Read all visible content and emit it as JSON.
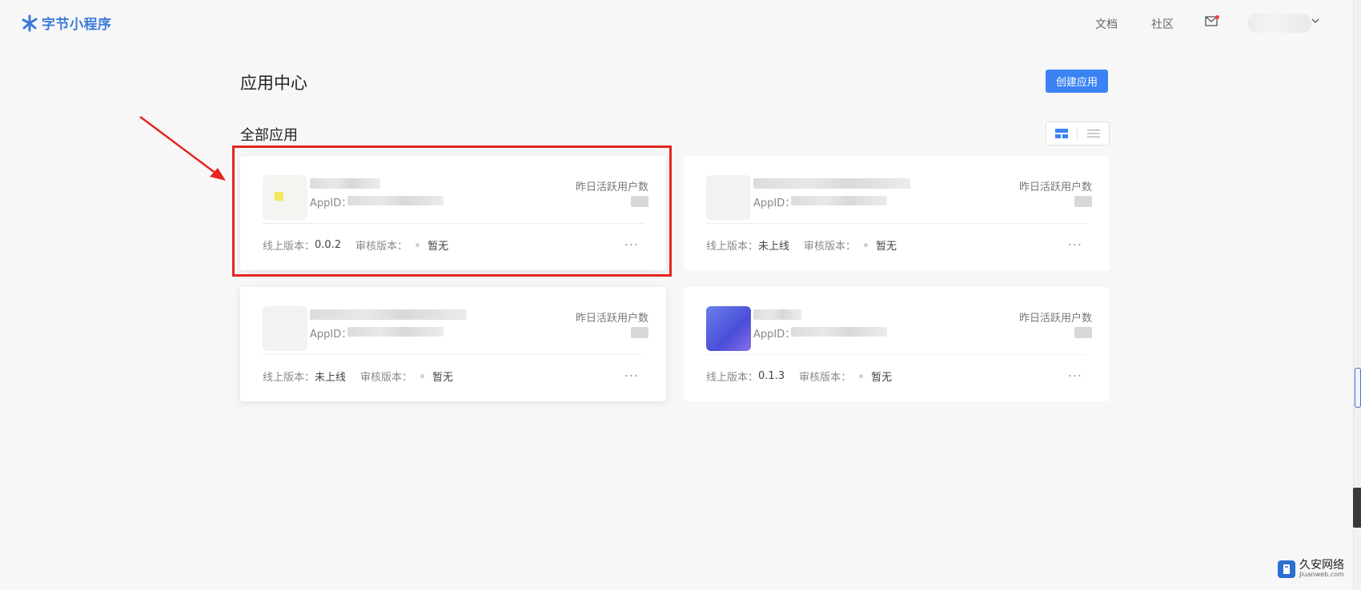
{
  "brand": {
    "name": "字节小程序",
    "color": "#3d7bd9"
  },
  "nav": {
    "docs": "文档",
    "community": "社区"
  },
  "page": {
    "title": "应用中心",
    "create_label": "创建应用",
    "section_title": "全部应用"
  },
  "colors": {
    "primary": "#3b83f4",
    "highlight": "#e5261f"
  },
  "cards": [
    {
      "appid_label": "AppID：",
      "dau_label": "昨日活跃用户数",
      "online_label": "线上版本：",
      "online_value": "0.0.2",
      "review_label": "审核版本：",
      "review_value": "暂无",
      "more": "..."
    },
    {
      "appid_label": "AppID：",
      "dau_label": "昨日活跃用户数",
      "online_label": "线上版本：",
      "online_value": "未上线",
      "review_label": "审核版本：",
      "review_value": "暂无",
      "more": "..."
    },
    {
      "appid_label": "AppID：",
      "dau_label": "昨日活跃用户数",
      "online_label": "线上版本：",
      "online_value": "未上线",
      "review_label": "审核版本：",
      "review_value": "暂无",
      "more": "..."
    },
    {
      "appid_label": "AppID：",
      "dau_label": "昨日活跃用户数",
      "online_label": "线上版本：",
      "online_value": "0.1.3",
      "review_label": "审核版本：",
      "review_value": "暂无",
      "more": "..."
    }
  ],
  "watermark": {
    "title": "久安网络",
    "sub": "Jiuanweb.com"
  }
}
